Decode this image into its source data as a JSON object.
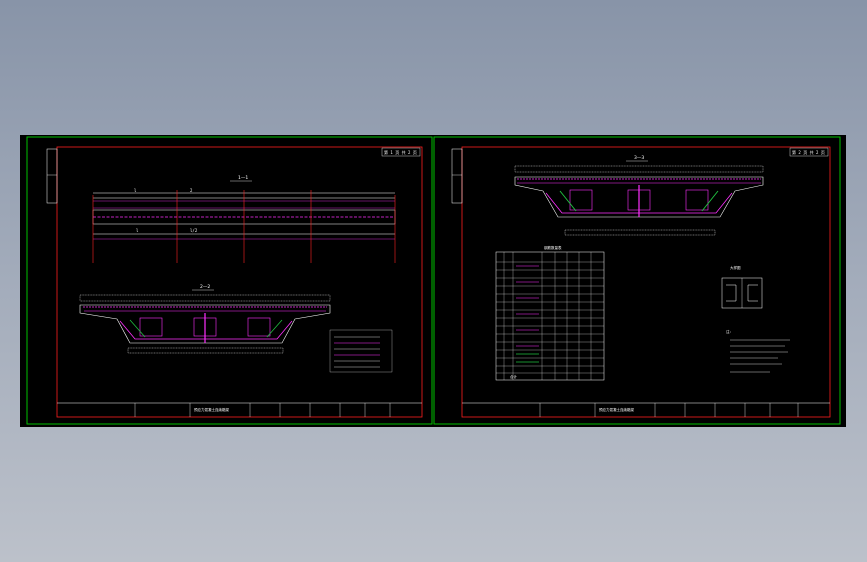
{
  "colors": {
    "background": "#000000",
    "sheet_border": "#00c000",
    "frame": "#ff2020",
    "outline": "#ffffff",
    "rebar": "#ff30ff",
    "concrete": "#d0d0d0",
    "accent": "#20c040"
  },
  "sheet_left": {
    "title_block_text": "预应力混凝土连续箱梁",
    "section_label_top": "1—1",
    "section_label_mid": "2—2",
    "page_box": "第 1 页 共 2 页",
    "dim_labels": [
      "l",
      "2",
      "l",
      "l/2"
    ]
  },
  "sheet_right": {
    "title_block_text": "预应力混凝土连续箱梁",
    "section_label_top": "3—3",
    "table_caption": "钢筋数量表",
    "table_footer": "合计",
    "page_box": "第 2 页 共 2 页",
    "detail_caption": "大样图",
    "notes_heading": "注："
  }
}
